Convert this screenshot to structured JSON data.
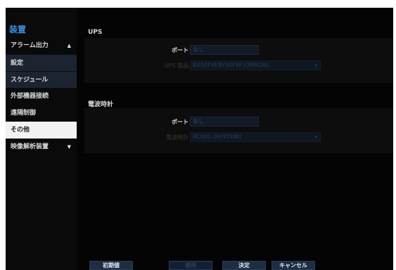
{
  "sidebar": {
    "title": "装置",
    "items": [
      {
        "label": "アラーム出力",
        "arrow": "▲"
      },
      {
        "label": "設定"
      },
      {
        "label": "スケジュール"
      },
      {
        "label": "外部機器接続"
      },
      {
        "label": "遠隔制御"
      },
      {
        "label": "その他"
      },
      {
        "label": "映像解析装置",
        "arrow": "▼"
      }
    ]
  },
  "ups": {
    "title": "UPS",
    "port_label": "ポート",
    "port_value": "なし",
    "product_label": "UPS 製品",
    "product_value": "BX50FW/BY50FW (OMRON)"
  },
  "clock": {
    "title": "電波時計",
    "port_label": "ポート",
    "port_value": "なし",
    "clock_label": "電波時計",
    "clock_value": "RC001 (RHYTHM)"
  },
  "buttons": {
    "default": "初期値",
    "apply": "適用",
    "ok": "決定",
    "cancel": "キャンセル"
  },
  "colors": {
    "accent": "#3d8fe0",
    "sidebar_sub_bg": "#1c2431",
    "button_bg": "#1e2d42"
  }
}
